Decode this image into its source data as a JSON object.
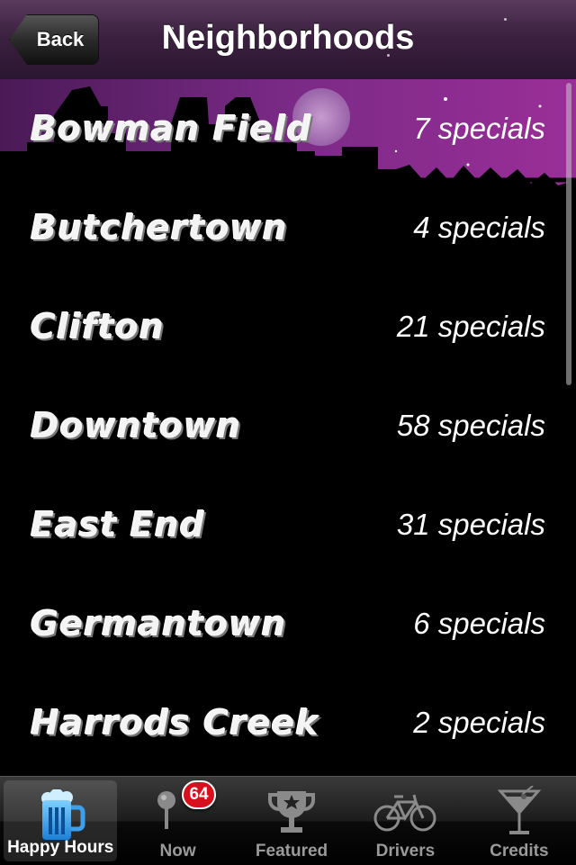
{
  "nav": {
    "title": "Neighborhoods",
    "back_label": "Back"
  },
  "neighborhoods": [
    {
      "name": "Bowman Field",
      "count": "7 specials"
    },
    {
      "name": "Butchertown",
      "count": "4 specials"
    },
    {
      "name": "Clifton",
      "count": "21 specials"
    },
    {
      "name": "Downtown",
      "count": "58 specials"
    },
    {
      "name": "East End",
      "count": "31 specials"
    },
    {
      "name": "Germantown",
      "count": "6 specials"
    },
    {
      "name": "Harrods Creek",
      "count": "2 specials"
    }
  ],
  "tabs": [
    {
      "label": "Happy Hours",
      "icon": "beer-mug-icon",
      "active": true
    },
    {
      "label": "Now",
      "icon": "map-pin-icon",
      "badge": "64"
    },
    {
      "label": "Featured",
      "icon": "trophy-icon"
    },
    {
      "label": "Drivers",
      "icon": "bicycle-icon"
    },
    {
      "label": "Credits",
      "icon": "martini-glass-icon"
    }
  ],
  "colors": {
    "header_purple": "#8a2a8e",
    "badge_red": "#d7101d",
    "background": "#000000"
  }
}
